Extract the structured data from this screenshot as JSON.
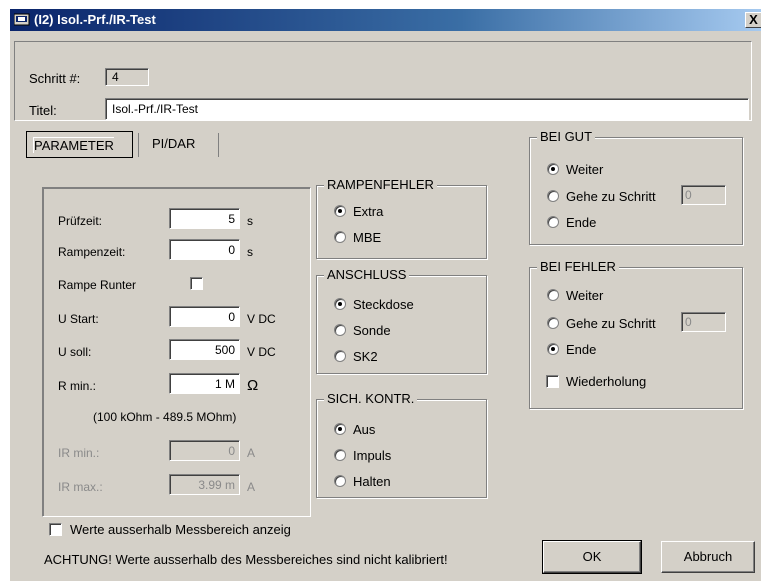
{
  "window": {
    "title": "(I2) Isol.-Prf./IR-Test",
    "close_label": "X"
  },
  "header": {
    "step_label": "Schritt #:",
    "step_value": "4",
    "title_label": "Titel:",
    "title_value": "Isol.-Prf./IR-Test"
  },
  "tabs": [
    {
      "label": "PARAMETER",
      "active": true
    },
    {
      "label": "PI/DAR",
      "active": false
    }
  ],
  "params": {
    "pruefzeit": {
      "label": "Prüfzeit:",
      "value": "5",
      "unit": "s"
    },
    "rampenzeit": {
      "label": "Rampenzeit:",
      "value": "0",
      "unit": "s"
    },
    "rampe_runter": {
      "label": "Rampe Runter",
      "checked": false
    },
    "u_start": {
      "label": "U Start:",
      "value": "0",
      "unit": "V DC"
    },
    "u_soll": {
      "label": "U soll:",
      "value": "500",
      "unit": "V DC"
    },
    "r_min": {
      "label": "R min.:",
      "value": "1 M",
      "unit": "Ω"
    },
    "range_text": "(100 kOhm - 489.5 MOhm)",
    "ir_min": {
      "label": "IR min.:",
      "value": "0",
      "unit": "A"
    },
    "ir_max": {
      "label": "IR max.:",
      "value": "3.99 m",
      "unit": "A"
    }
  },
  "rampenfehler": {
    "title": "RAMPENFEHLER",
    "options": [
      {
        "label": "Extra",
        "selected": true
      },
      {
        "label": "MBE",
        "selected": false
      }
    ]
  },
  "anschluss": {
    "title": "ANSCHLUSS",
    "options": [
      {
        "label": "Steckdose",
        "selected": true
      },
      {
        "label": "Sonde",
        "selected": false
      },
      {
        "label": "SK2",
        "selected": false
      }
    ]
  },
  "sich_kontr": {
    "title": "SICH. KONTR.",
    "options": [
      {
        "label": "Aus",
        "selected": true
      },
      {
        "label": "Impuls",
        "selected": false
      },
      {
        "label": "Halten",
        "selected": false
      }
    ]
  },
  "bei_gut": {
    "title": "BEI GUT",
    "options": [
      {
        "label": "Weiter",
        "selected": true
      },
      {
        "label": "Gehe zu Schritt",
        "selected": false
      },
      {
        "label": "Ende",
        "selected": false
      }
    ],
    "step_value": "0"
  },
  "bei_fehler": {
    "title": "BEI FEHLER",
    "options": [
      {
        "label": "Weiter",
        "selected": false
      },
      {
        "label": "Gehe zu Schritt",
        "selected": false
      },
      {
        "label": "Ende",
        "selected": true
      }
    ],
    "step_value": "0",
    "repeat_label": "Wiederholung",
    "repeat_checked": false
  },
  "footer": {
    "out_of_range_label": "Werte ausserhalb Messbereich anzeig",
    "out_of_range_checked": false,
    "warning": "ACHTUNG! Werte ausserhalb des Messbereiches sind nicht kalibriert!",
    "ok_label": "OK",
    "cancel_label": "Abbruch"
  }
}
